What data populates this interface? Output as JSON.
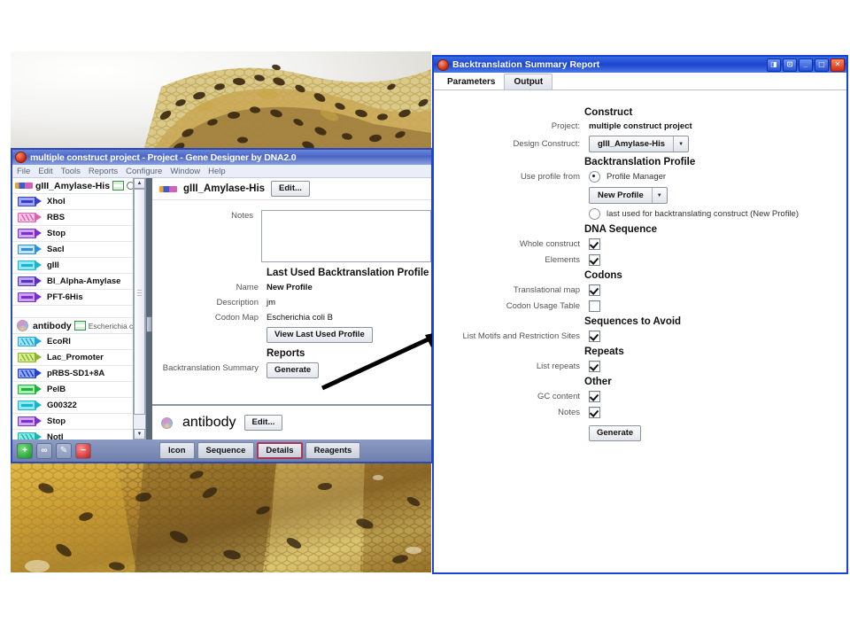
{
  "background": {
    "description": "bee honeycomb photograph"
  },
  "gene_designer": {
    "title": "multiple construct project - Project - Gene Designer by DNA2.0",
    "icon": "dna2-app-icon",
    "menu": [
      "File",
      "Edit",
      "Tools",
      "Reports",
      "Configure",
      "Window",
      "Help"
    ],
    "tree": {
      "groups": [
        {
          "name": "gIII_Amylase-His",
          "icon": "dna-bar-icon",
          "organism": "",
          "elements": [
            {
              "label": "XhoI",
              "type": "restriction",
              "fill": "#9aa8f0",
              "stroke": "#3c3ccc"
            },
            {
              "label": "RBS",
              "type": "helix",
              "fill": "#ffc8e8",
              "stroke": "#e060b0"
            },
            {
              "label": "Stop",
              "type": "plain",
              "fill": "#cfa8f0",
              "stroke": "#7c2ed0"
            },
            {
              "label": "SacI",
              "type": "plain",
              "fill": "#bfe4fb",
              "stroke": "#2f8fd8"
            },
            {
              "label": "gIII",
              "type": "plain",
              "fill": "#8fe8f4",
              "stroke": "#18b6cc"
            },
            {
              "label": "Bl_Alpha-Amylase",
              "type": "plain",
              "fill": "#b9a4ee",
              "stroke": "#5a2fc4"
            },
            {
              "label": "PFT-6His",
              "type": "plain",
              "fill": "#c8a4f2",
              "stroke": "#7c2ed0"
            }
          ]
        },
        {
          "name": "antibody",
          "icon": "circular-plasmid-icon",
          "organism": "Escherichia co",
          "elements": [
            {
              "label": "EcoRI",
              "type": "helix",
              "fill": "#9fe4f8",
              "stroke": "#22a8d8"
            },
            {
              "label": "Lac_Promoter",
              "type": "helix",
              "fill": "#d8ef9a",
              "stroke": "#8cb42a"
            },
            {
              "label": "pRBS-SD1+8A",
              "type": "helix",
              "fill": "#8fa8f4",
              "stroke": "#2440c8"
            },
            {
              "label": "PelB",
              "type": "plain",
              "fill": "#a8efb0",
              "stroke": "#22b040"
            },
            {
              "label": "G00322",
              "type": "plain",
              "fill": "#8fe8f4",
              "stroke": "#18b6cc"
            },
            {
              "label": "Stop",
              "type": "plain",
              "fill": "#cfa8f0",
              "stroke": "#7c2ed0"
            },
            {
              "label": "NotI",
              "type": "helix",
              "fill": "#8fe8e4",
              "stroke": "#18b6b0"
            }
          ]
        }
      ]
    },
    "detail": {
      "construct_title": "gIII_Amylase-His",
      "edit_label": "Edit...",
      "notes_label": "Notes",
      "notes_value": "",
      "profile_section": "Last Used Backtranslation Profile",
      "name_label": "Name",
      "name_value": "New Profile",
      "description_label": "Description",
      "description_value": "jm",
      "codon_map_label": "Codon Map",
      "codon_map_value": "Escherichia coli B",
      "view_profile_label": "View Last Used Profile",
      "reports_section": "Reports",
      "backtranslation_label": "Backtranslation Summary",
      "generate_label": "Generate",
      "second_title": "antibody",
      "second_edit_label": "Edit..."
    },
    "toolbar_icons": [
      "add-icon",
      "duplicate-icon",
      "edit-icon",
      "delete-icon"
    ],
    "view_tabs": [
      {
        "label": "Icon",
        "selected": false
      },
      {
        "label": "Sequence",
        "selected": false
      },
      {
        "label": "Details",
        "selected": true
      },
      {
        "label": "Reagents",
        "selected": false
      }
    ]
  },
  "backtranslation_dialog": {
    "title": "Backtranslation Summary Report",
    "icon": "dna2-app-icon",
    "window_buttons": [
      "restore-split-icon",
      "maximize-pane-icon",
      "minimize-icon",
      "maximize-icon",
      "close-icon"
    ],
    "tabs": [
      {
        "label": "Parameters",
        "selected": true
      },
      {
        "label": "Output",
        "selected": false
      }
    ],
    "sections": {
      "construct": {
        "heading": "Construct",
        "project_label": "Project:",
        "project_value": "multiple construct project",
        "design_construct_label": "Design Construct:",
        "design_construct_value": "gIII_Amylase-His"
      },
      "profile": {
        "heading": "Backtranslation Profile",
        "use_profile_label": "Use profile from",
        "option_profile_manager": "Profile Manager",
        "option_profile_manager_selected": true,
        "profile_value": "New Profile",
        "option_last_used": "last used for backtranslating construct (New Profile)",
        "option_last_used_selected": false
      },
      "dna_sequence": {
        "heading": "DNA Sequence",
        "items": [
          {
            "label": "Whole construct",
            "checked": true
          },
          {
            "label": "Elements",
            "checked": true
          }
        ]
      },
      "codons": {
        "heading": "Codons",
        "items": [
          {
            "label": "Translational map",
            "checked": true
          },
          {
            "label": "Codon Usage Table",
            "checked": false
          }
        ]
      },
      "sequences_to_avoid": {
        "heading": "Sequences to Avoid",
        "items": [
          {
            "label": "List Motifs and Restriction Sites",
            "checked": true
          }
        ]
      },
      "repeats": {
        "heading": "Repeats",
        "items": [
          {
            "label": "List repeats",
            "checked": true
          }
        ]
      },
      "other": {
        "heading": "Other",
        "items": [
          {
            "label": "GC content",
            "checked": true
          },
          {
            "label": "Notes",
            "checked": true
          }
        ]
      }
    },
    "generate_label": "Generate"
  },
  "annotation": {
    "arrow": "arrow-pointing-from-generate-to-dialog"
  },
  "colors": {
    "gd_title": "#4a66c4",
    "bt_title": "#1b45cf",
    "bt_border": "#1a44d6",
    "selected_tab_outline": "#a8374f"
  }
}
